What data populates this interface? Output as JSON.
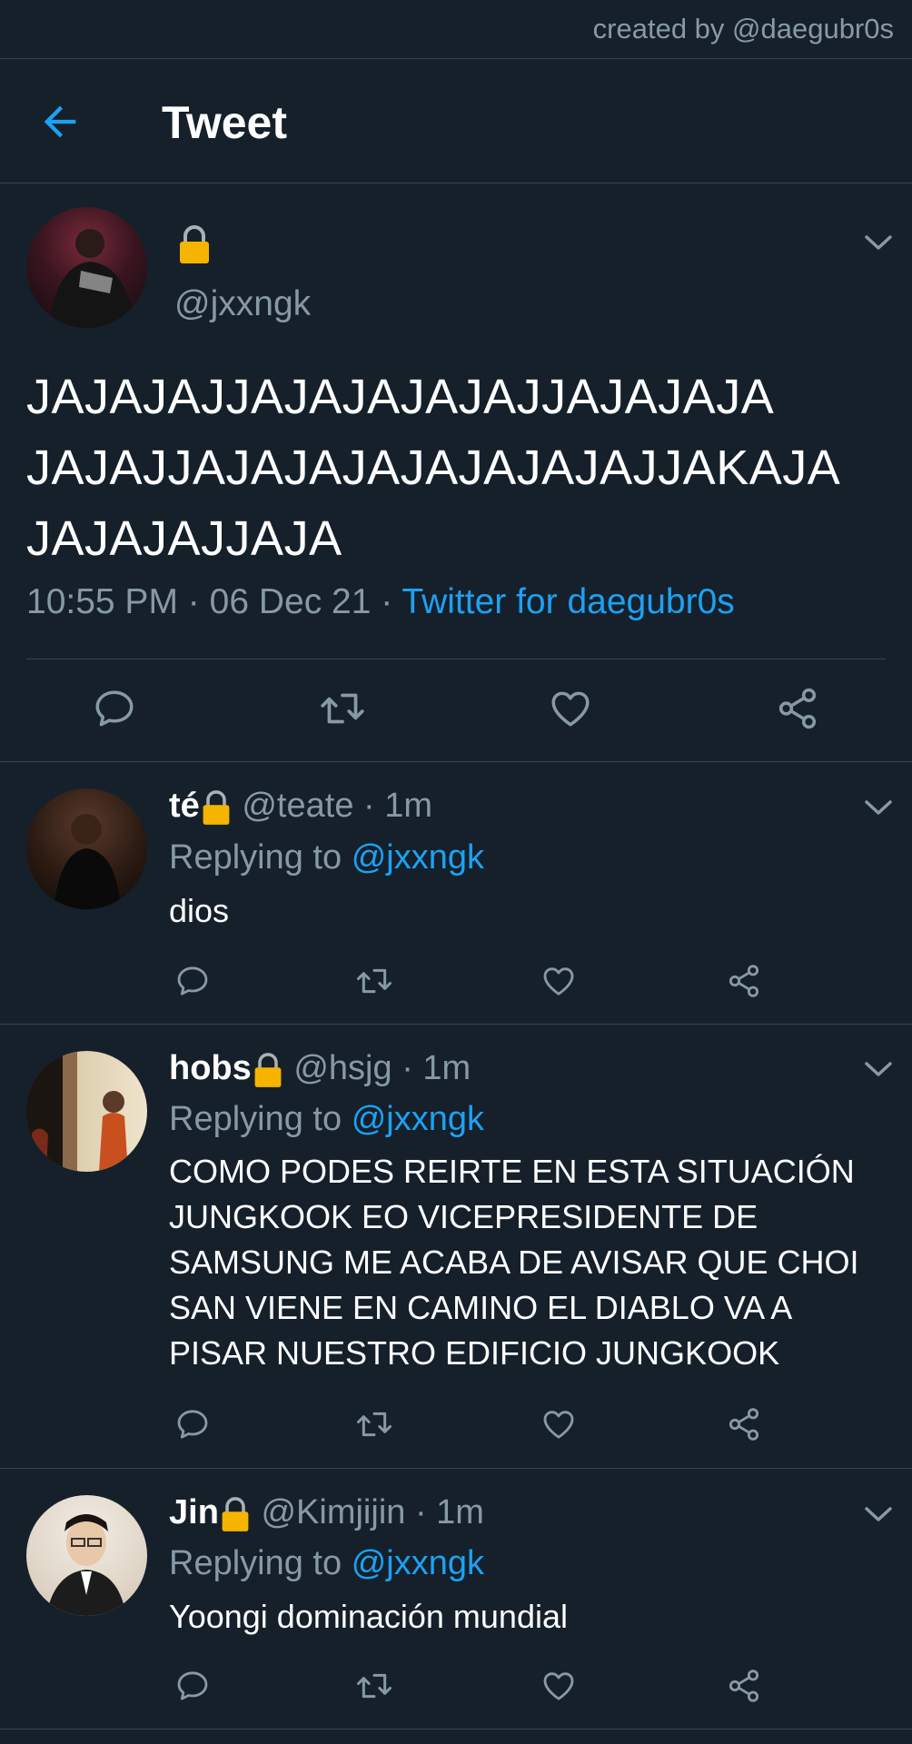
{
  "watermark": "created by @daegubr0s",
  "header": {
    "title": "Tweet"
  },
  "main_tweet": {
    "handle": "@jxxngk",
    "text_lines": [
      "JAJAJAJJAJAJAJAJAJJAJAJAJA",
      "JAJAJJAJAJAJAJAJAJAJAJJAKAJA",
      "JAJAJAJJAJA"
    ],
    "time": "10:55 PM",
    "date": "06 Dec 21",
    "source": "Twitter for daegubr0s",
    "separator": "·"
  },
  "replies": [
    {
      "name": "té",
      "handle": "@teate",
      "time": "1m",
      "replying_label": "Replying to",
      "replying_handle": "@jxxngk",
      "text_lines": [
        "dios"
      ]
    },
    {
      "name": "hobs",
      "handle": "@hsjg",
      "time": "1m",
      "replying_label": "Replying to",
      "replying_handle": "@jxxngk",
      "text_lines": [
        "COMO PODES REIRTE EN ESTA SITUACIÓN",
        "JUNGKOOK EO VICEPRESIDENTE DE",
        "SAMSUNG ME ACABA DE AVISAR QUE CHOI",
        "SAN VIENE EN CAMINO EL DIABLO VA A",
        "PISAR NUESTRO EDIFICIO JUNGKOOK"
      ]
    },
    {
      "name": "Jin",
      "handle": "@Kimjijin",
      "time": "1m",
      "replying_label": "Replying to",
      "replying_handle": "@jxxngk",
      "text_lines": [
        "Yoongi dominación mundial"
      ]
    }
  ],
  "colors": {
    "background": "#15202b",
    "accent": "#1da1f2",
    "muted": "#8899a6",
    "divider": "#38444d",
    "lock": "#f5b400"
  },
  "icons": [
    "arrow-left-icon",
    "lock-icon",
    "chevron-down-icon",
    "reply-icon",
    "retweet-icon",
    "like-icon",
    "share-icon"
  ]
}
